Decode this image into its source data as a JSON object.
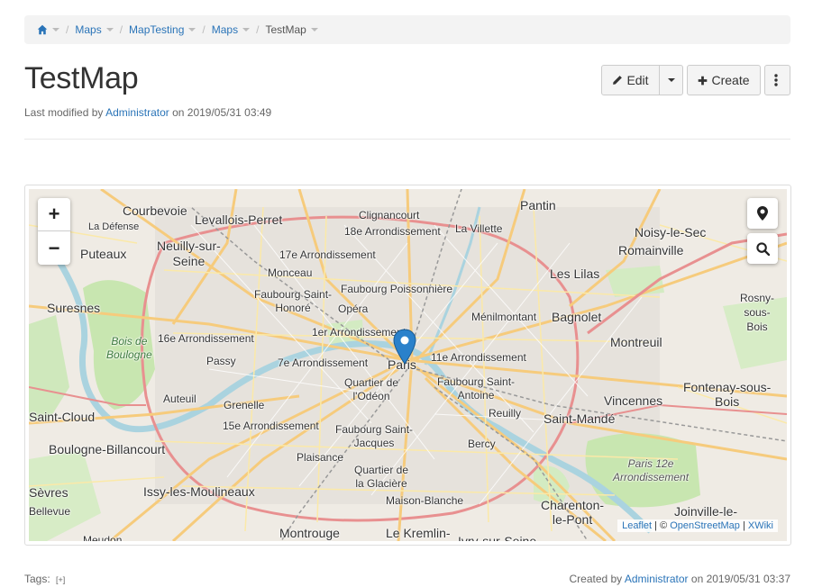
{
  "breadcrumb": {
    "items": [
      {
        "label": "Maps"
      },
      {
        "label": "MapTesting"
      },
      {
        "label": "Maps"
      }
    ],
    "current": "TestMap"
  },
  "page": {
    "title": "TestMap",
    "modified_prefix": "Last modified by",
    "modified_user": "Administrator",
    "modified_date": "on 2019/05/31 03:49"
  },
  "toolbar": {
    "edit_label": "Edit",
    "create_label": "Create"
  },
  "map": {
    "zoom_in": "+",
    "zoom_out": "−",
    "attribution": {
      "leaflet": "Leaflet",
      "sep1": " | © ",
      "osm": "OpenStreetMap",
      "sep2": " | ",
      "xwiki": "XWiki"
    },
    "labels": {
      "courbevoie": "Courbevoie",
      "ladefense": "La Défense",
      "levallois": "Levallois-Perret",
      "clignancourt": "Clignancourt",
      "pantin": "Pantin",
      "arr18": "18e Arrondissement",
      "lavillette": "La Villette",
      "noisy": "Noisy-le-Sec",
      "puteaux": "Puteaux",
      "neuilly": "Neuilly-sur-\nSeine",
      "arr17": "17e Arrondissement",
      "romainville": "Romainville",
      "monceau": "Monceau",
      "leslilas": "Les Lilas",
      "fbgstHonore": "Faubourg Saint-\nHonoré",
      "fbgPoisso": "Faubourg Poissonnière",
      "rosny": "Rosny-sous-\nBois",
      "opera": "Opéra",
      "suresnes": "Suresnes",
      "menilmontant": "Ménilmontant",
      "bagnolet": "Bagnolet",
      "boisBoulogne": "Bois de\nBoulogne",
      "arr16": "16e Arrondissement",
      "arr1": "1er Arrondissement",
      "montreuil": "Montreuil",
      "passy": "Passy",
      "arr7": "7e Arrondissement",
      "paris": "Paris",
      "arr11": "11e Arrondissement",
      "quartierOdeon": "Quartier de\nl'Odéon",
      "fbgstAntoine": "Faubourg Saint-\nAntoine",
      "fontenay": "Fontenay-sous-\nBois",
      "auteuil": "Auteuil",
      "grenelle": "Grenelle",
      "vincennes": "Vincennes",
      "saintcloud": "Saint-Cloud",
      "reuilly": "Reuilly",
      "saintmande": "Saint-Mandé",
      "arr15": "15e Arrondissement",
      "fbgstJacques": "Faubourg Saint-\nJacques",
      "bercy": "Bercy",
      "boulogne": "Boulogne-Billancourt",
      "plaisance": "Plaisance",
      "paris12": "Paris 12e\nArrondissement",
      "quartierGlaciere": "Quartier de\nla Glacière",
      "sevres": "Sèvres",
      "issy": "Issy-les-Moulineaux",
      "maisonBlanche": "Maison-Blanche",
      "charenton": "Charenton-\nle-Pont",
      "joinville": "Joinville-le-",
      "bellevue": "Bellevue",
      "meudon": "Meudon",
      "montrouge": "Montrouge",
      "kremlin": "Le Kremlin-",
      "ivry": "Ivry-sur-Seine"
    }
  },
  "footer": {
    "tags_label": "Tags:",
    "tags_add": "[+]",
    "created_prefix": "Created by",
    "created_user": "Administrator",
    "created_date": "on 2019/05/31 03:37"
  },
  "colors": {
    "link": "#2a74b8",
    "marker": "#2a81cb",
    "park": "#c8e6b0",
    "water": "#aad3df",
    "road_major": "#f6cb7c",
    "road_primary": "#e89090"
  }
}
